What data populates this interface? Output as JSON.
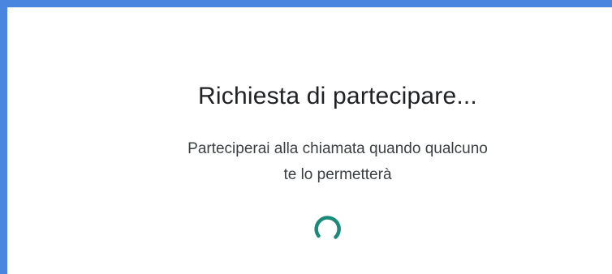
{
  "dialog": {
    "title": "Richiesta di partecipare...",
    "message_line1": "Parteciperai alla chiamata quando qualcuno",
    "message_line2": "te lo permetterà",
    "spinner_icon": "loading-spinner-icon"
  },
  "colors": {
    "frame_border": "#4a86e0",
    "spinner": "#1a8a7a",
    "title_text": "#202124",
    "body_text": "#3c4043"
  }
}
